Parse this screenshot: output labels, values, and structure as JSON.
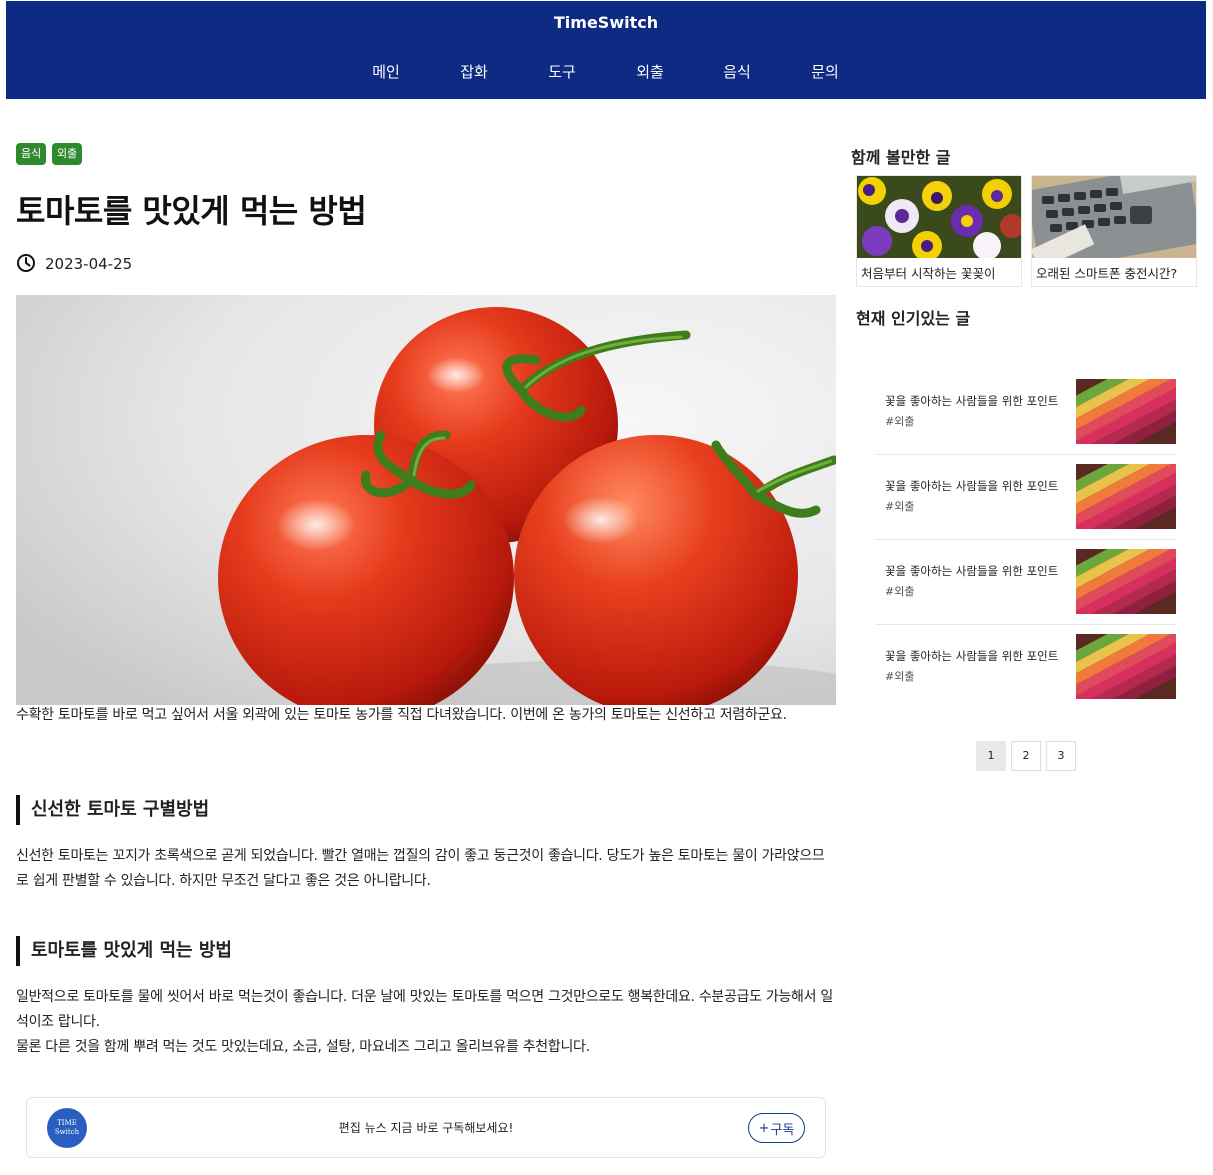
{
  "site": {
    "title": "TimeSwitch"
  },
  "nav": [
    {
      "label": "메인"
    },
    {
      "label": "잡화"
    },
    {
      "label": "도구"
    },
    {
      "label": "외출"
    },
    {
      "label": "음식"
    },
    {
      "label": "문의"
    }
  ],
  "post": {
    "categories": [
      "음식",
      "외출"
    ],
    "title": "토마토를 맛있게 먹는 방법",
    "date": "2023-04-25",
    "date_icon": "clock-icon",
    "image_subject": "tomatoes",
    "intro": "수확한 토마토를 바로 먹고 싶어서 서울 외곽에 있는 토마토 농가를 직접 다녀왔습니다. 이번에 온 농가의 토마토는 신선하고 저렴하군요.",
    "sections": [
      {
        "heading": "신선한 토마토 구별방법",
        "body": "신선한 토마토는 꼬지가 초록색으로 곧게 되었습니다. 빨간 열매는 껍질의 감이 좋고 둥근것이 좋습니다. 당도가 높은 토마토는 물이 가라앉으므로 쉽게 판별할 수 있습니다. 하지만 무조건 달다고 좋은 것은 아니랍니다."
      },
      {
        "heading": "토마토를 맛있게 먹는 방법",
        "body": "일반적으로 토마토를 물에 씻어서 바로 먹는것이 좋습니다. 더운 날에 맛있는 토마토를 먹으면 그것만으로도 행복한데요. 수분공급도 가능해서 일석이조 랍니다.",
        "body2": "물론 다른 것을 함께 뿌려 먹는 것도 맛있는데요, 소금, 설탕, 마요네즈 그리고 올리브유를 추천합니다."
      }
    ]
  },
  "subscribe": {
    "logo_line1": "TIME",
    "logo_line2": "Switch",
    "text": "편집 뉴스 지금 바로 구독해보세요!",
    "button_label": "구독",
    "button_icon": "plus-icon"
  },
  "sidebar": {
    "related_heading": "함께 볼만한 글",
    "related": [
      {
        "title": "처음부터 시작하는 꽃꽂이",
        "image_subject": "purple and yellow pansies"
      },
      {
        "title": "오래된 스마트폰 충전시간?",
        "image_subject": "e-reader keyboard"
      }
    ],
    "popular_heading": "현재 인기있는 글",
    "popular": [
      {
        "title": "꽃을 좋아하는 사람들을 위한 포인트",
        "tag": "#외출"
      },
      {
        "title": "꽃을 좋아하는 사람들을 위한 포인트",
        "tag": "#외출"
      },
      {
        "title": "꽃을 좋아하는 사람들을 위한 포인트",
        "tag": "#외출"
      },
      {
        "title": "꽃을 좋아하는 사람들을 위한 포인트",
        "tag": "#외출"
      }
    ],
    "pagination": {
      "pages": [
        "1",
        "2",
        "3"
      ],
      "current": "1"
    }
  },
  "colors": {
    "header_bg": "#0e2a82",
    "tag_bg": "#2f8a2f",
    "subscribe_accent": "#1a3a8a"
  }
}
